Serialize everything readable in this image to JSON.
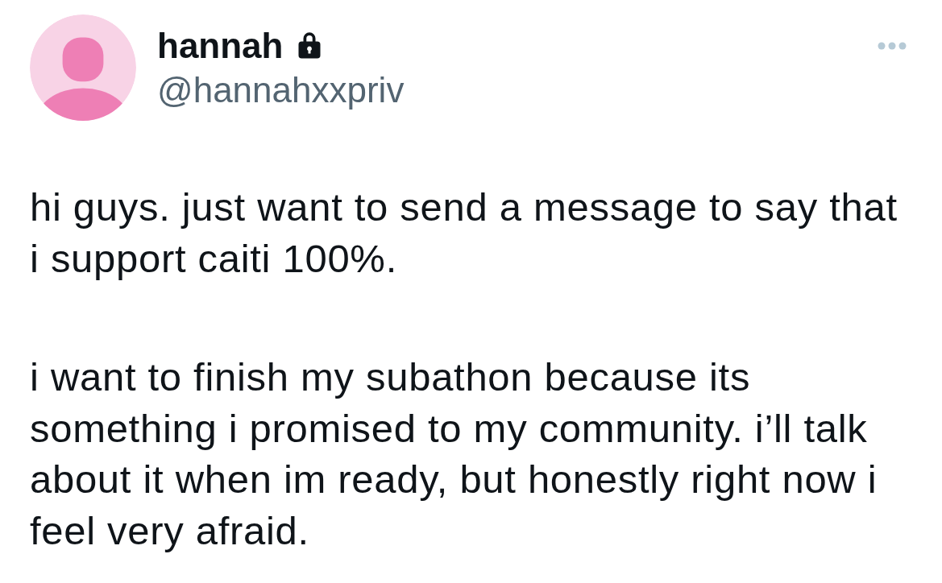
{
  "tweet": {
    "author": {
      "display_name": "hannah",
      "protected": true,
      "handle": "@hannahxxpriv"
    },
    "more_menu": true,
    "paragraphs": [
      "hi guys. just want to send a message to say that i support caiti 100%.",
      "i want to finish my subathon because its something i promised to my community. i’ll talk about it when im ready, but honestly right now i feel very afraid."
    ]
  }
}
